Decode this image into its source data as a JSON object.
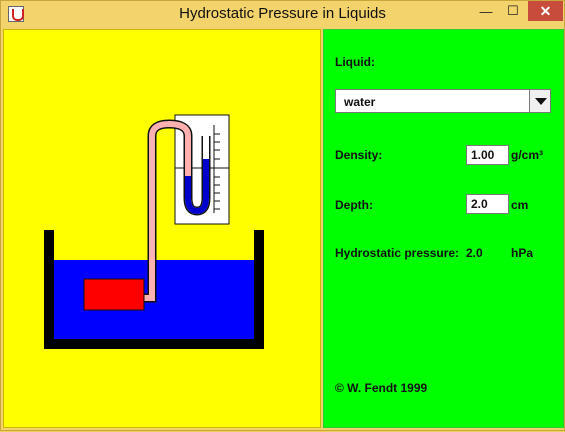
{
  "window": {
    "title": "Hydrostatic Pressure in Liquids",
    "minimize_glyph": "—",
    "maximize_glyph": "☐",
    "close_glyph": "✕"
  },
  "controls": {
    "liquid_label": "Liquid:",
    "liquid_selected": "water",
    "density_label": "Density:",
    "density_value": "1.00",
    "density_unit": "g/cm³",
    "depth_label": "Depth:",
    "depth_value": "2.0",
    "depth_unit": "cm",
    "pressure_label": "Hydrostatic pressure:",
    "pressure_value": "2.0",
    "pressure_unit": "hPa",
    "copyright": "©  W. Fendt 1999"
  },
  "colors": {
    "left_background": "#ffff00",
    "right_background": "#00ff00",
    "liquid": "#0000ff",
    "probe": "#ff0000",
    "tube": "#ffb0b0"
  }
}
